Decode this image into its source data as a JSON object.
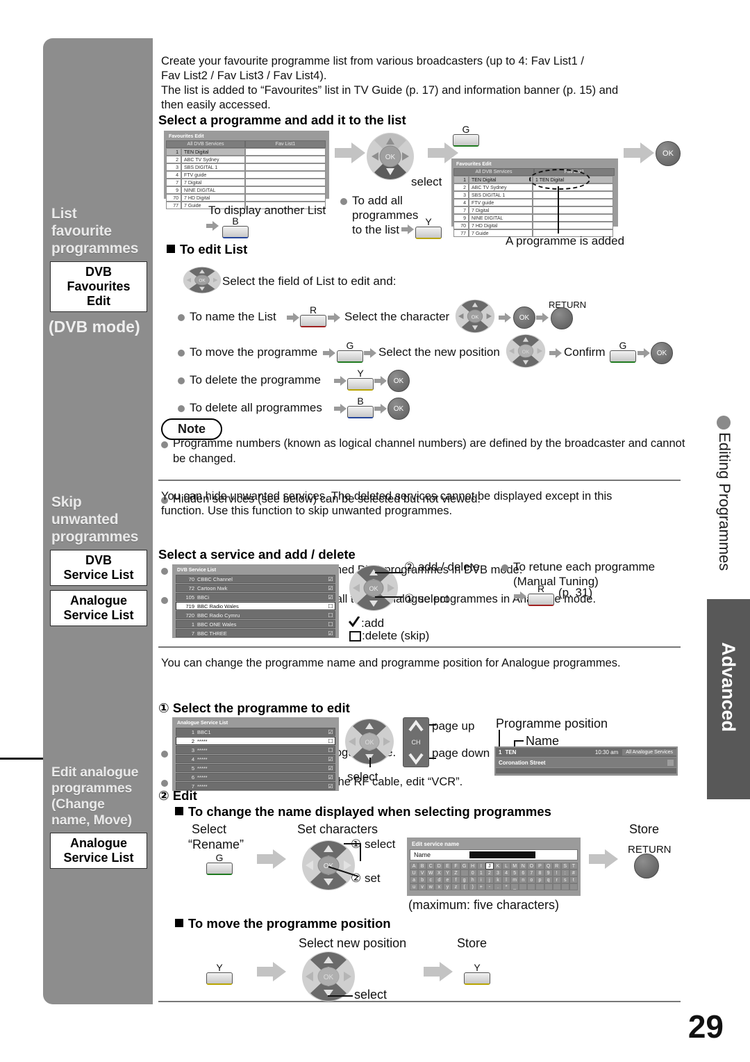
{
  "page_number": "29",
  "side_tabs": {
    "advanced": "Advanced",
    "editing": "Editing Programmes"
  },
  "sidebar": {
    "sections": [
      {
        "title": "List\nfavourite\nprogrammes",
        "chips": [
          "DVB\nFavourites\nEdit"
        ],
        "mode": "(DVB mode)"
      },
      {
        "title": "Skip\nunwanted\nprogrammes",
        "chips": [
          "DVB\nService List",
          "Analogue\nService List"
        ],
        "mode": ""
      },
      {
        "title": "Edit analogue\nprogrammes\n(Change\nname, Move)",
        "chips": [
          "Analogue\nService List"
        ],
        "mode": ""
      }
    ]
  },
  "section1": {
    "intro_line1": "Create your favourite programme list from various broadcasters (up to 4: Fav List1 /",
    "intro_line2": "Fav List2 / Fav List3 / Fav List4).",
    "intro_line3": "The list is added to “Favourites” list in TV Guide (p. 17) and information banner (p. 15) and",
    "intro_line4": "then easily accessed.",
    "heading": "Select a programme and add it to the list",
    "screen1": {
      "title": "Favourites Edit",
      "col1": "All DVB Services",
      "col2": "Fav List1",
      "rows": [
        {
          "no": "1",
          "name": "TEN Digital",
          "selected": true
        },
        {
          "no": "2",
          "name": "ABC TV Sydney",
          "selected": false
        },
        {
          "no": "3",
          "name": "SBS DIGITAL 1",
          "selected": false
        },
        {
          "no": "4",
          "name": "FTV guide",
          "selected": false
        },
        {
          "no": "7",
          "name": "7 Digital",
          "selected": false
        },
        {
          "no": "9",
          "name": "NINE DIGITAL",
          "selected": false
        },
        {
          "no": "70",
          "name": "7 HD Digital",
          "selected": false
        },
        {
          "no": "77",
          "name": "7 Guide",
          "selected": false
        }
      ],
      "fav_rows": [
        "",
        "",
        "",
        "",
        "",
        "",
        "",
        ""
      ]
    },
    "screen2": {
      "title": "Favourites Edit",
      "col1": "All DVB Services",
      "col2": "Fav List1",
      "rows": [
        {
          "no": "1",
          "name": "TEN Digital",
          "selected": true
        },
        {
          "no": "2",
          "name": "ABC TV Sydney",
          "selected": false
        },
        {
          "no": "3",
          "name": "SBS DIGITAL 1",
          "selected": false
        },
        {
          "no": "4",
          "name": "FTV guide",
          "selected": false
        },
        {
          "no": "7",
          "name": "7 Digital",
          "selected": false
        },
        {
          "no": "9",
          "name": "NINE DIGITAL",
          "selected": false
        },
        {
          "no": "70",
          "name": "7 HD Digital",
          "selected": false
        },
        {
          "no": "77",
          "name": "7 Guide",
          "selected": false
        }
      ],
      "fav_first": "1  TEN Digital"
    },
    "labels": {
      "select": "select",
      "display_another": "To display another List",
      "add_all_1": "To add all",
      "add_all_2": "programmes",
      "add_all_3": "to the list",
      "programme_added": "A programme is added",
      "key_b": "B",
      "key_y": "Y",
      "key_g": "G",
      "ok": "OK"
    },
    "edit_list_heading": "To edit List",
    "edit_select_field": "Select the field of List to edit and:",
    "steps": [
      {
        "text": "To name the List",
        "key": "R",
        "mid": "Select the character",
        "after_ok": "OK",
        "return": "RETURN"
      },
      {
        "text": "To move the programme",
        "key": "G",
        "mid": "Select the new position",
        "confirm": "Confirm",
        "key2": "G",
        "ok": "OK"
      },
      {
        "text": "To delete the programme",
        "key": "Y",
        "ok": "OK"
      },
      {
        "text": "To delete all programmes",
        "key": "B",
        "ok": "OK"
      }
    ],
    "note_label": "Note",
    "notes": [
      "Programme numbers (known as logical channel numbers) are defined by the broadcaster and cannot be changed.",
      "Hidden services (see below) can be selected but not viewed."
    ]
  },
  "section2": {
    "intro_line1": "You can hide unwanted services. The deleted services cannot be displayed except in this",
    "intro_line2": "function. Use this function to skip unwanted programmes.",
    "bullets": [
      "“DVB Service List” is listed all tuned DVB programmes in DVB mode.",
      "“Analogue Service List” is listed all tuned Analogue programmes in Analogue mode."
    ],
    "heading": "Select a service and add / delete",
    "screen": {
      "title": "DVB Service List",
      "rows": [
        {
          "no": "70",
          "name": "CBBC Channel",
          "checked": true,
          "highlight": false
        },
        {
          "no": "72",
          "name": "Cartoon Nwk",
          "checked": true,
          "highlight": false
        },
        {
          "no": "105",
          "name": "BBCi",
          "checked": true,
          "highlight": false
        },
        {
          "no": "719",
          "name": "BBC Radio Wales",
          "checked": false,
          "highlight": true
        },
        {
          "no": "720",
          "name": "BBC Radio Cymru",
          "checked": false,
          "highlight": false
        },
        {
          "no": "1",
          "name": "BBC ONE Wales",
          "checked": false,
          "highlight": false
        },
        {
          "no": "7",
          "name": "BBC THREE",
          "checked": true,
          "highlight": false
        }
      ]
    },
    "labels": {
      "step2": "add / delete",
      "step1": "select",
      "legend_add": ":add",
      "legend_del": ":delete (skip)",
      "retune_1": "To retune each programme",
      "retune_2": "(Manual Tuning)",
      "retune_key": "R",
      "retune_page": "(p. 31)"
    }
  },
  "section3": {
    "intro_line1": "You can change the programme name and programme position for Analogue programmes.",
    "bullets": [
      "This function is available in Analogue mode.",
      "If a VCR is connected only with the RF cable, edit “VCR”."
    ],
    "step1_heading": "Select the programme to edit",
    "screen": {
      "title": "Analogue Service List",
      "rows": [
        {
          "no": "1",
          "name": "BBC1",
          "checked": true,
          "highlight": false
        },
        {
          "no": "2",
          "name": "*****",
          "checked": false,
          "highlight": true
        },
        {
          "no": "3",
          "name": "*****",
          "checked": false,
          "highlight": false
        },
        {
          "no": "4",
          "name": "*****",
          "checked": true,
          "highlight": false
        },
        {
          "no": "5",
          "name": "*****",
          "checked": true,
          "highlight": false
        },
        {
          "no": "6",
          "name": "*****",
          "checked": true,
          "highlight": false
        },
        {
          "no": "7",
          "name": "*****",
          "checked": true,
          "highlight": false
        }
      ]
    },
    "labels": {
      "select": "select",
      "page_up": "page up",
      "page_down": "page down",
      "ch": "CH",
      "prog_position": "Programme position",
      "name": "Name"
    },
    "banner": {
      "position": "1",
      "name": "TEN",
      "time": "10:30 am",
      "service": "All Analogue Services",
      "programme": "Coronation Street"
    },
    "step2_heading": "Edit",
    "change_name_heading": "To change the name displayed when selecting programmes",
    "change_name": {
      "select_1": "Select",
      "select_2": "“Rename”",
      "key_g": "G",
      "set_characters": "Set characters",
      "step1": "select",
      "step2": "set",
      "store": "Store",
      "return": "RETURN",
      "max_chars": "(maximum: five characters)"
    },
    "keyboard": {
      "title": "Edit service name",
      "name_label": "Name",
      "highlight_key": "J",
      "rows": [
        [
          "A",
          "B",
          "C",
          "D",
          "E",
          "F",
          "G",
          "H",
          "I",
          "J",
          "K",
          "L",
          "M",
          "N",
          "O",
          "P",
          "Q",
          "R",
          "S",
          "T"
        ],
        [
          "U",
          "V",
          "W",
          "X",
          "Y",
          "Z",
          "",
          "0",
          "1",
          "2",
          "3",
          "4",
          "5",
          "6",
          "7",
          "8",
          "9",
          "!",
          ":",
          "#"
        ],
        [
          "a",
          "b",
          "c",
          "d",
          "e",
          "f",
          "g",
          "h",
          "i",
          "j",
          "k",
          "l",
          "m",
          "n",
          "o",
          "p",
          "q",
          "r",
          "s",
          "t"
        ],
        [
          "u",
          "v",
          "w",
          "x",
          "y",
          "z",
          "(",
          ")",
          "+",
          "-",
          ".",
          "*",
          "_",
          "",
          "",
          "",
          "",
          "",
          "",
          ""
        ]
      ]
    },
    "move_heading": "To move the programme position",
    "move": {
      "key_y1": "Y",
      "select_new": "Select new position",
      "select": "select",
      "store": "Store",
      "key_y2": "Y"
    }
  }
}
